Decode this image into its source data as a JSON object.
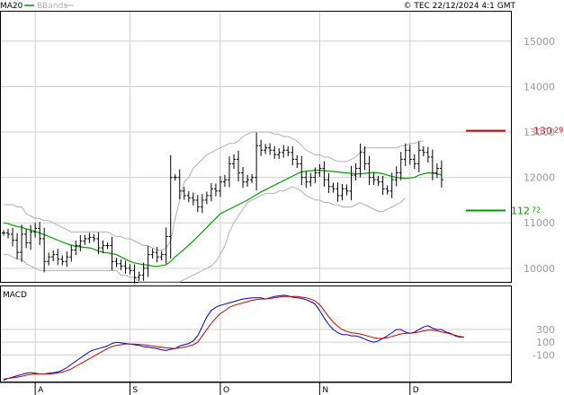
{
  "header": {
    "ma_label": "MA20",
    "bb_label": "BBands",
    "copyright": "© TEC 22/12/2024 4:1 GMT"
  },
  "panels": {
    "macd_title": "MACD"
  },
  "colors": {
    "price": "#000000",
    "ma": "#00a000",
    "bands": "#b0b0b0",
    "grid": "#cfcfcf",
    "resistance": "#cc0000",
    "support": "#009900",
    "macd": "#0000cc",
    "signal": "#cc0000"
  },
  "chart_data": [
    {
      "type": "ohlc",
      "y_ticks": [
        "10000",
        "11000",
        "12000",
        "13000",
        "14000",
        "15000"
      ],
      "y_tick_values": [
        10000,
        11000,
        12000,
        13000,
        14000,
        15000
      ],
      "ylim": [
        9700,
        15650
      ],
      "x_labels": [
        "A",
        "S",
        "O",
        "N",
        "D"
      ],
      "levels": [
        {
          "name": "resistance",
          "value": 13029,
          "label": "13029"
        },
        {
          "name": "support",
          "value": 11272,
          "label": "11272"
        }
      ],
      "x_count": 103,
      "month_index": [
        7,
        28,
        48,
        70,
        90
      ],
      "close": [
        10780,
        10750,
        10620,
        10350,
        10750,
        10560,
        10800,
        10880,
        10650,
        10150,
        10250,
        10300,
        10200,
        10150,
        10250,
        10400,
        10500,
        10600,
        10650,
        10680,
        10650,
        10450,
        10500,
        10500,
        10150,
        10100,
        10050,
        10000,
        9950,
        9800,
        9850,
        10000,
        10300,
        10350,
        10250,
        10300,
        10700,
        12000,
        12000,
        11700,
        11600,
        11550,
        11500,
        11350,
        11500,
        11600,
        11750,
        11700,
        11900,
        11950,
        12300,
        12400,
        12100,
        11900,
        11950,
        12000,
        12700,
        12600,
        12650,
        12600,
        12500,
        12550,
        12600,
        12550,
        12400,
        12300,
        12000,
        11900,
        12000,
        12100,
        12200,
        11950,
        11800,
        11750,
        11600,
        11750,
        11700,
        12050,
        12200,
        12550,
        12300,
        12000,
        11950,
        11900,
        11750,
        11700,
        11950,
        12100,
        12400,
        12600,
        12400,
        12300,
        12600,
        12550,
        12450,
        12100,
        12200,
        11950
      ],
      "ma": [
        11000,
        10980,
        10950,
        10920,
        10900,
        10870,
        10840,
        10810,
        10780,
        10740,
        10700,
        10660,
        10620,
        10580,
        10540,
        10510,
        10480,
        10470,
        10460,
        10450,
        10420,
        10380,
        10350,
        10340,
        10320,
        10300,
        10250,
        10200,
        10150,
        10120,
        10100,
        10080,
        10070,
        10050,
        10040,
        10060,
        10080,
        10150,
        10250,
        10330,
        10420,
        10510,
        10600,
        10700,
        10800,
        10900,
        11000,
        11100,
        11200,
        11250,
        11300,
        11350,
        11400,
        11450,
        11500,
        11560,
        11620,
        11680,
        11730,
        11780,
        11830,
        11880,
        11930,
        11980,
        12030,
        12080,
        12120,
        12140,
        12150,
        12160,
        12160,
        12150,
        12140,
        12130,
        12120,
        12110,
        12100,
        12090,
        12080,
        12080,
        12090,
        12100,
        12110,
        12100,
        12080,
        12050,
        12020,
        12000,
        11990,
        11980,
        11990,
        12000,
        12050,
        12080,
        12100,
        12100,
        12080,
        12050
      ],
      "band_upper": [
        11400,
        11400,
        11400,
        11350,
        11350,
        11200,
        11150,
        11100,
        11100,
        11050,
        11050,
        11000,
        10950,
        10900,
        10850,
        10800,
        10800,
        10800,
        10800,
        10800,
        10800,
        10800,
        10800,
        10800,
        10750,
        10700,
        10700,
        10650,
        10650,
        10600,
        10550,
        10500,
        10500,
        10450,
        10400,
        10400,
        10450,
        10600,
        11100,
        11500,
        11900,
        12000,
        12200,
        12300,
        12400,
        12500,
        12550,
        12600,
        12650,
        12700,
        12750,
        12750,
        12800,
        12900,
        12950,
        13000,
        13000,
        13000,
        13000,
        13000,
        12950,
        12950,
        12900,
        12900,
        12850,
        12800,
        12700,
        12600,
        12550,
        12500,
        12500,
        12450,
        12450,
        12400,
        12350,
        12350,
        12350,
        12400,
        12450,
        12550,
        12650,
        12650,
        12650,
        12650,
        12650,
        12650,
        12650,
        12650,
        12700,
        12700,
        12750,
        12750,
        12800,
        12800
      ],
      "band_lower": [
        10300,
        10300,
        10250,
        10200,
        10200,
        10100,
        10050,
        10000,
        9950,
        9950,
        9950,
        9950,
        9950,
        9950,
        9950,
        9950,
        9950,
        9950,
        9950,
        9950,
        9950,
        9950,
        9950,
        9950,
        9950,
        9950,
        9850,
        9850,
        9800,
        9800,
        9700,
        9700,
        9700,
        9700,
        9700,
        9700,
        9700,
        9700,
        9700,
        9700,
        9750,
        9800,
        9850,
        9900,
        9950,
        10000,
        10050,
        10150,
        10300,
        10500,
        10800,
        11000,
        11150,
        11300,
        11450,
        11500,
        11550,
        11600,
        11650,
        11650,
        11650,
        11700,
        11700,
        11750,
        11800,
        11750,
        11700,
        11600,
        11550,
        11500,
        11500,
        11450,
        11450,
        11400,
        11400,
        11350,
        11350,
        11350,
        11400,
        11450,
        11400,
        11350,
        11300,
        11250,
        11250,
        11300,
        11350,
        11400,
        11450,
        11550
      ]
    },
    {
      "type": "line",
      "title": "MACD",
      "y_ticks": [
        "300",
        "100",
        "-100"
      ],
      "y_tick_values": [
        300,
        100,
        -100
      ],
      "ylim": [
        -520,
        980
      ],
      "series": [
        {
          "name": "macd",
          "values": [
            -500,
            -470,
            -450,
            -430,
            -410,
            -390,
            -380,
            -390,
            -400,
            -400,
            -390,
            -380,
            -370,
            -340,
            -300,
            -250,
            -200,
            -150,
            -100,
            -50,
            -20,
            0,
            20,
            40,
            80,
            100,
            90,
            80,
            70,
            60,
            50,
            30,
            20,
            10,
            0,
            -20,
            -30,
            -10,
            0,
            40,
            60,
            80,
            120,
            200,
            350,
            500,
            600,
            650,
            680,
            700,
            720,
            740,
            760,
            780,
            790,
            800,
            800,
            800,
            780,
            800,
            820,
            830,
            840,
            830,
            810,
            800,
            790,
            770,
            740,
            700,
            600,
            480,
            380,
            300,
            250,
            220,
            220,
            200,
            200,
            180,
            150,
            120,
            100,
            120,
            160,
            200,
            250,
            300,
            300,
            260,
            240,
            260,
            300,
            340,
            360,
            320,
            300,
            300,
            260,
            240,
            200,
            180,
            180
          ]
        },
        {
          "name": "signal",
          "values": [
            -480,
            -470,
            -460,
            -450,
            -440,
            -420,
            -410,
            -400,
            -400,
            -400,
            -400,
            -395,
            -385,
            -370,
            -350,
            -320,
            -280,
            -240,
            -200,
            -160,
            -120,
            -80,
            -40,
            0,
            30,
            50,
            60,
            70,
            70,
            70,
            65,
            60,
            50,
            40,
            30,
            20,
            10,
            5,
            0,
            10,
            20,
            40,
            60,
            100,
            200,
            300,
            400,
            480,
            550,
            600,
            650,
            680,
            700,
            720,
            740,
            760,
            770,
            780,
            780,
            790,
            800,
            810,
            820,
            820,
            820,
            820,
            810,
            800,
            780,
            750,
            690,
            600,
            500,
            420,
            350,
            300,
            270,
            250,
            240,
            230,
            210,
            190,
            170,
            160,
            160,
            170,
            190,
            210,
            230,
            240,
            240,
            250,
            260,
            280,
            290,
            290,
            280,
            260,
            250,
            230,
            210,
            190,
            180
          ]
        }
      ]
    }
  ]
}
